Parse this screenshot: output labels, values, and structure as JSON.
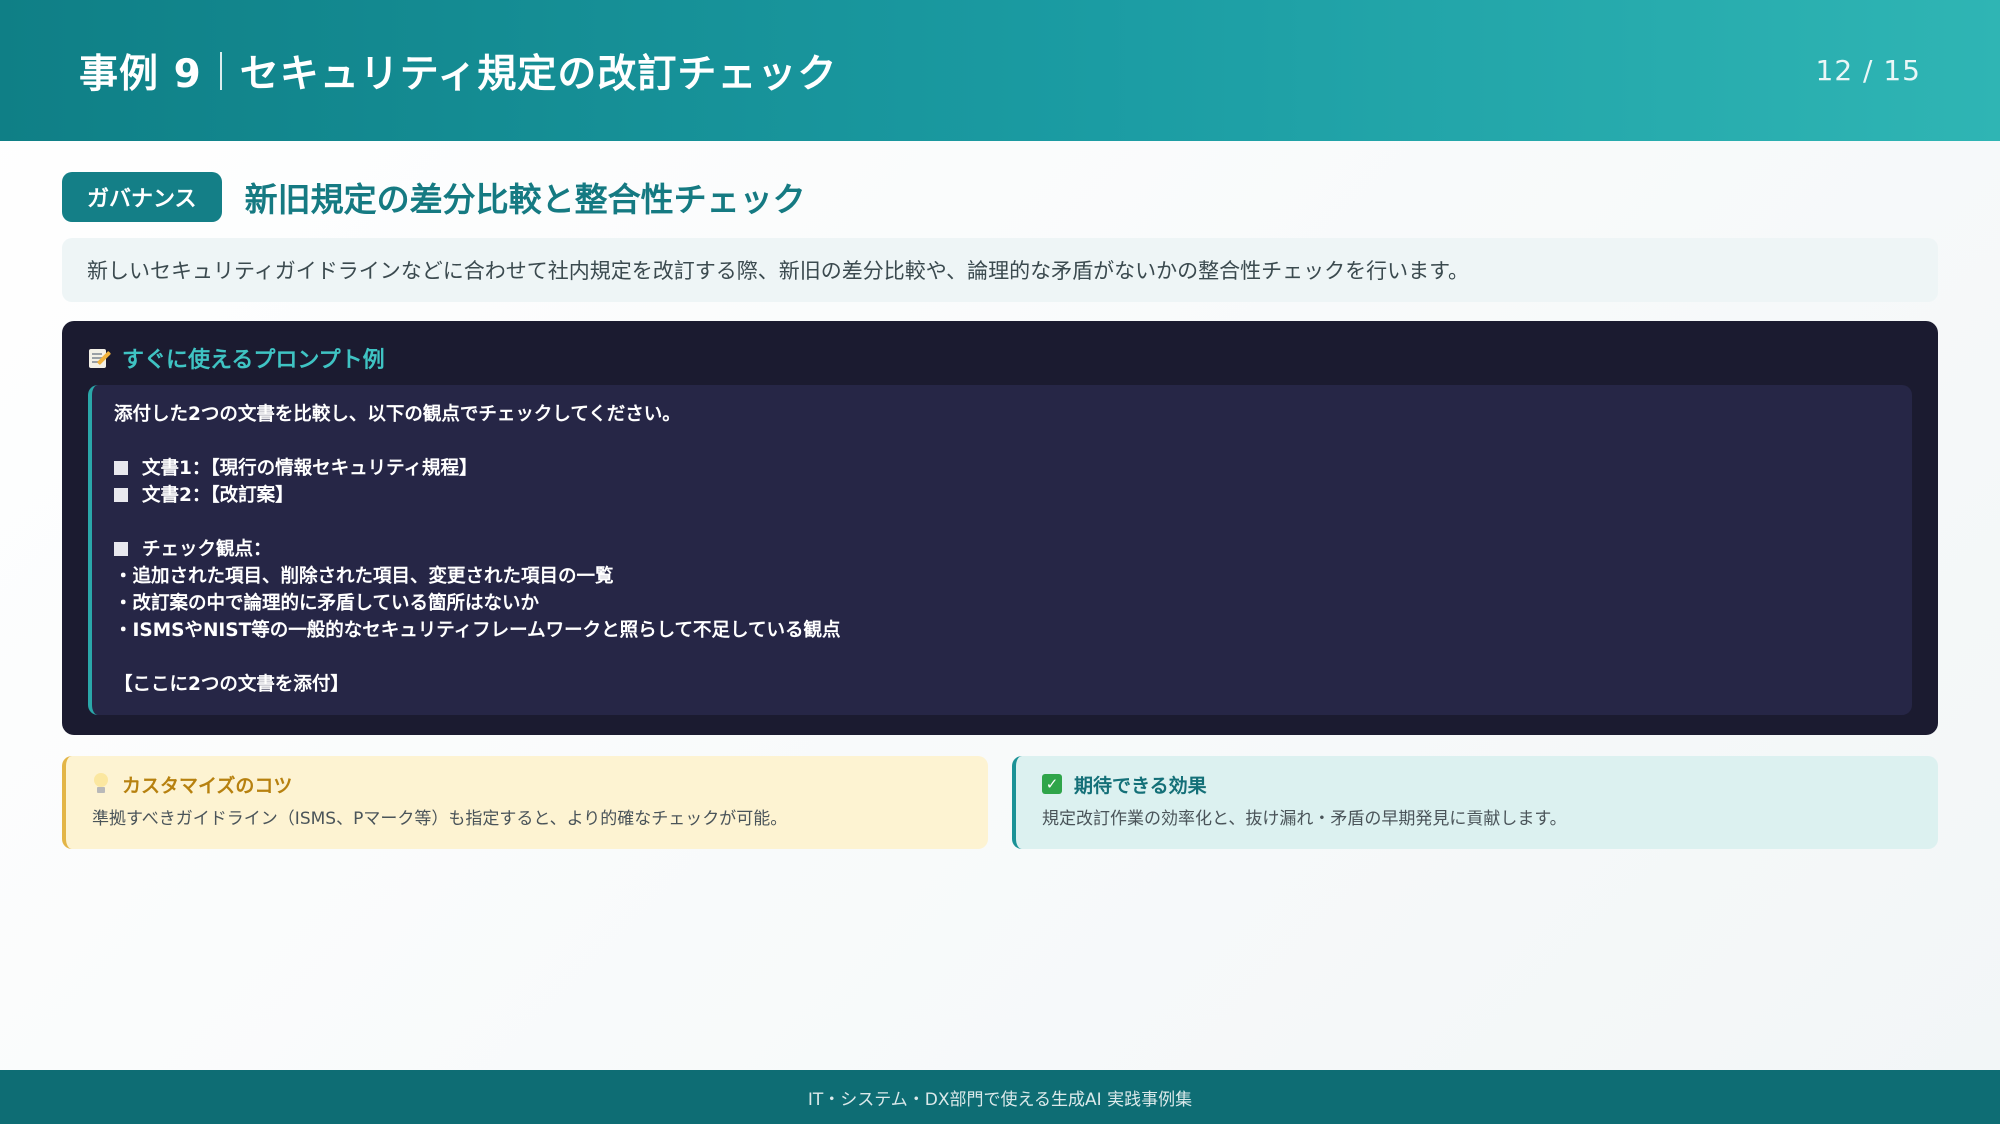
{
  "header": {
    "case_label": "事例 9",
    "title": "セキュリティ規定の改訂チェック",
    "page_indicator": "12 / 15"
  },
  "section": {
    "tag": "ガバナンス",
    "subtitle": "新旧規定の差分比較と整合性チェック",
    "description": "新しいセキュリティガイドラインなどに合わせて社内規定を改訂する際、新旧の差分比較や、論理的な矛盾がないかの整合性チェックを行います。"
  },
  "prompt": {
    "label": "すぐに使えるプロンプト例",
    "icon": "memo-icon",
    "intro": "添付した2つの文書を比較し、以下の観点でチェックしてください。",
    "doc1": "文書1：【現行の情報セキュリティ規程】",
    "doc2": "文書2：【改訂案】",
    "check_head": "チェック観点：",
    "point1": "・追加された項目、削除された項目、変更された項目の一覧",
    "point2": "・改訂案の中で論理的に矛盾している箇所はないか",
    "point3": "・ISMSやNIST等の一般的なセキュリティフレームワークと照らして不足している観点",
    "attach": "【ここに2つの文書を添付】"
  },
  "tips": {
    "icon": "lightbulb-icon",
    "title": "カスタマイズのコツ",
    "text": "準拠すべきガイドライン（ISMS、Pマーク等）も指定すると、より的確なチェックが可能。"
  },
  "effect": {
    "icon": "check-box-icon",
    "title": "期待できる効果",
    "text": "規定改訂作業の効率化と、抜け漏れ・矛盾の早期発見に貢献します。"
  },
  "footer": {
    "text": "IT・システム・DX部門で使える生成AI 実践事例集"
  },
  "colors": {
    "header_start": "#0f7f86",
    "header_end": "#2fb5b4",
    "accent": "#157a82",
    "prompt_bg": "#1b1b30",
    "tips_bg": "#fdf3d2",
    "effect_bg": "#dcf1f0",
    "footer_bg": "#0e6d74"
  }
}
